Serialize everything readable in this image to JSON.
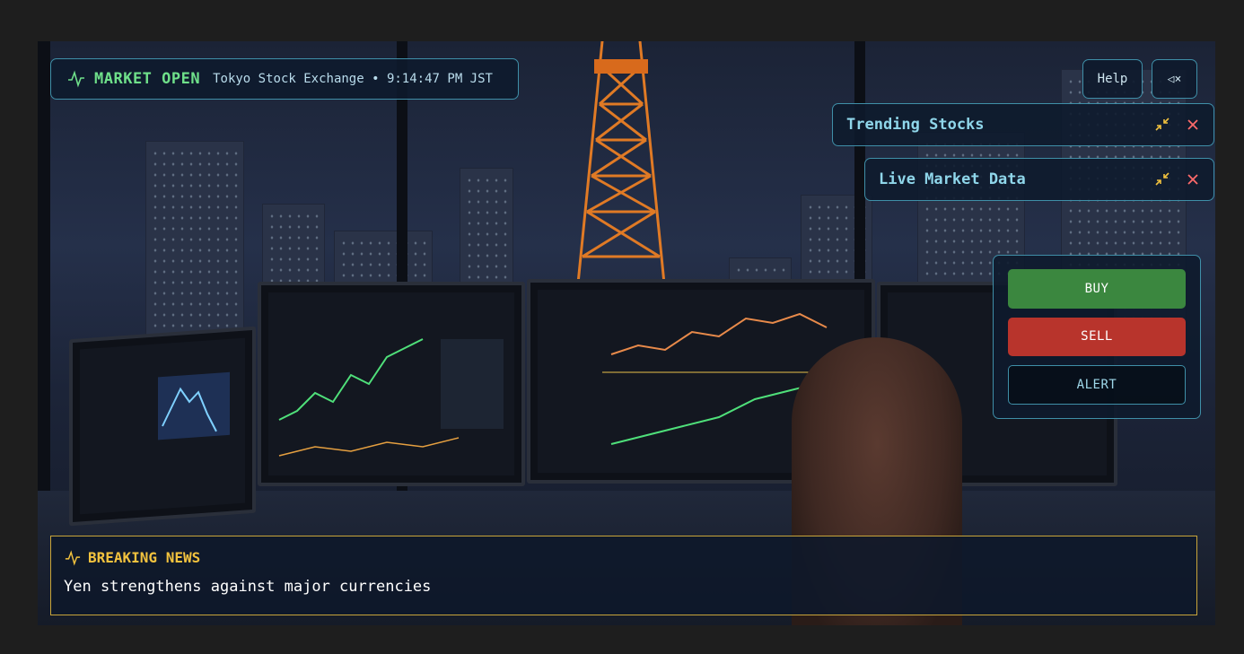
{
  "status_bar": {
    "label": "MARKET OPEN",
    "detail": "Tokyo Stock Exchange • 9:14:47 PM JST",
    "icon": "pulse-icon",
    "color": "#6fe08a"
  },
  "controls": {
    "help_label": "Help",
    "mute_label": "◁×",
    "mute_icon": "mute-icon"
  },
  "widgets": [
    {
      "title": "Trending Stocks",
      "minimize_icon": "minimize-icon",
      "close_icon": "close-icon"
    },
    {
      "title": "Live Market Data",
      "minimize_icon": "minimize-icon",
      "close_icon": "close-icon"
    }
  ],
  "trade_panel": {
    "buy_label": "BUY",
    "sell_label": "SELL",
    "alert_label": "ALERT",
    "buy_color": "#3b873f",
    "sell_color": "#b8342c"
  },
  "news": {
    "title": "BREAKING NEWS",
    "headline": "Yen strengthens against major currencies",
    "icon": "pulse-icon",
    "accent": "#f2c23e"
  }
}
